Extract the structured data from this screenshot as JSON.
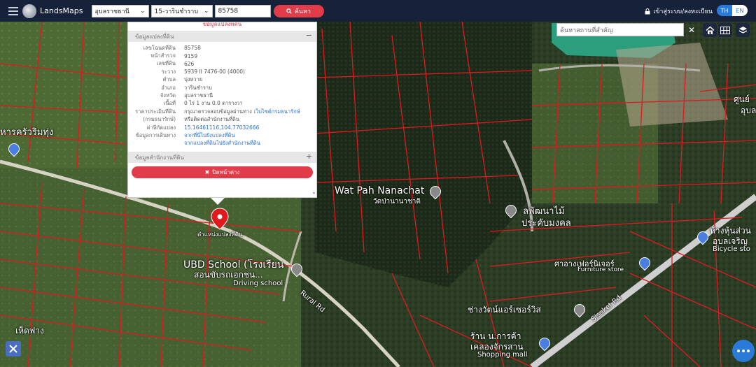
{
  "header": {
    "brand": "LandsMaps",
    "province": "อุบลราชธานี",
    "district": "15-วารินชำราบ",
    "parcel_input": "85758",
    "search_label": "ค้นหา",
    "login_label": "เข้าสู่ระบบ/ลงทะเบียน",
    "lang": [
      "TH",
      "EN"
    ]
  },
  "panel": {
    "top_link": "ข้อมูลแปลงที่ดิน",
    "section1_title": "ข้อมูลแปลงที่ดิน",
    "section1_toggle": "−",
    "rows": [
      {
        "k": "เลขโฉนดที่ดิน",
        "v": "85758"
      },
      {
        "k": "หน้าสำรวจ",
        "v": "9159"
      },
      {
        "k": "เลขที่ดิน",
        "v": "626"
      },
      {
        "k": "ระวาง",
        "v": "5939 II 7476-00 (4000)"
      },
      {
        "k": "ตำบล",
        "v": "บุ่งหวาย"
      },
      {
        "k": "อำเภอ",
        "v": "วารินชำราบ"
      },
      {
        "k": "จังหวัด",
        "v": "อุบลราชธานี"
      },
      {
        "k": "เนื้อที่",
        "v": "0 ไร่ 1 งาน 0.0 ตารางวา"
      },
      {
        "k": "ราคาประเมินที่ดิน",
        "v": "กรุณาตรวจสอบข้อมูลผ่านทาง"
      },
      {
        "k": "(กรมธนารักษ์)",
        "v": "หรือติดต่อสำนักงานที่ดิน"
      },
      {
        "k": "ค่าพิกัดแปลง",
        "v": "15.16461116,104.77032666"
      },
      {
        "k": "ข้อมูลการเดินทาง",
        "v": "จากที่นี่ไปยังแปลงที่ดิน"
      },
      {
        "k": "",
        "v": "จากแปลงที่ดินไปยังสำนักงานที่ดิน"
      }
    ],
    "price_link": "เว็บไซต์กรมธนารักษ์",
    "section2_title": "ข้อมูลสำนักงานที่ดิน",
    "section2_toggle": "+",
    "close_label": "ปิดหน้าต่าง"
  },
  "map": {
    "poi_search_placeholder": "ค้นหาสถานที่สำคัญ",
    "pin_label": "ตำแหน่งแปลงที่ดิน",
    "places": {
      "wat": "Wat Pah Nanachat",
      "wat_th": "วัดป่านานาชาติ",
      "school": "UBD School (โรงเรียน",
      "school2": "สอนขับรถเอกชน...",
      "school3": "Driving school",
      "rural_rd": "Rural Rd",
      "sisaket_rd": "Sisaket Rd",
      "restaurant": "หารครัวริมทุ่ง",
      "phatthana": "ลพัฒนาไม้",
      "prasop": "ประคับมงคล",
      "furniture_th": "ศาอางเฟอร์นิเจอร์",
      "furniture_en": "Furniture store",
      "chang": "ช่างวัตน์แอร์เซอร์วิส",
      "shop1": "ร้าน น.การค้า",
      "shop2": "เคลองจักรสาน",
      "shop3": "Shopping mall",
      "mall1": "ห้างหุ้นส่วน",
      "mall2": "อุบลเจริญ",
      "bicycle": "Bicycle sto",
      "right_edge1": "ศูนย์",
      "right_edge2": "อุบล",
      "bottom_left": "เห็ดฟาง"
    }
  }
}
